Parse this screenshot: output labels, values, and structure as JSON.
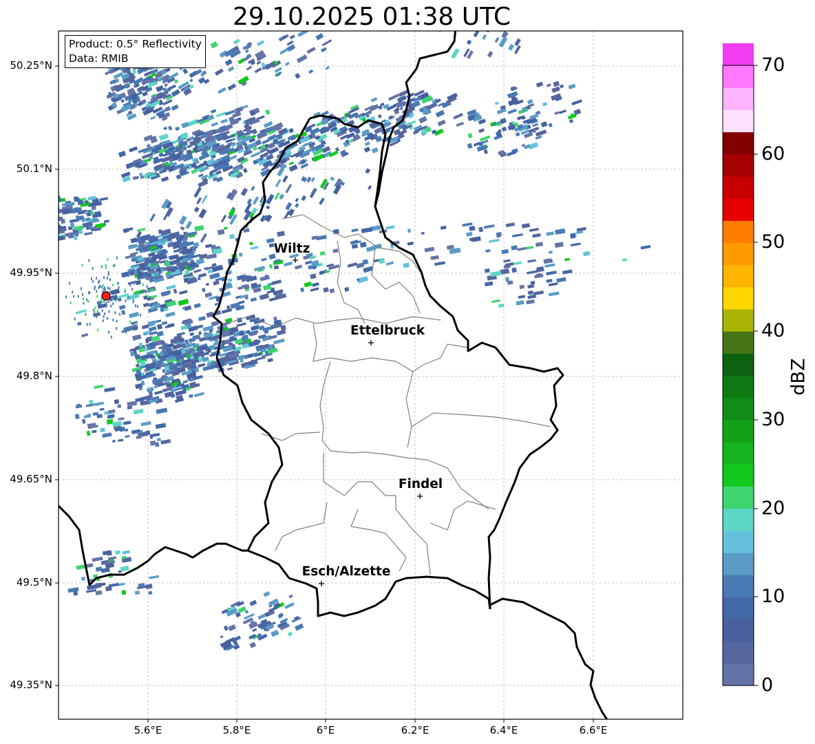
{
  "title": "29.10.2025 01:38 UTC",
  "info": {
    "product": "Product: 0.5° Reflectivity",
    "source": "Data: RMIB"
  },
  "axes": {
    "lat_labels": [
      "50.25°N",
      "50.1°N",
      "49.95°N",
      "49.8°N",
      "49.65°N",
      "49.5°N",
      "49.35°N"
    ],
    "lon_labels": [
      "5.6°E",
      "5.8°E",
      "6°E",
      "6.2°E",
      "6.4°E",
      "6.6°E"
    ]
  },
  "cities": [
    {
      "name": "Wiltz",
      "lon": 5.933,
      "lat": 49.966
    },
    {
      "name": "Ettelbruck",
      "lon": 6.104,
      "lat": 49.847
    },
    {
      "name": "Findel",
      "lon": 6.21,
      "lat": 49.626
    },
    {
      "name": "Esch/Alzette",
      "lon": 5.99,
      "lat": 49.496
    }
  ],
  "radar_site": {
    "lon": 5.505,
    "lat": 49.914,
    "color": "#ff2020"
  },
  "colorbar": {
    "label": "dBZ",
    "ticks": [
      "0",
      "10",
      "20",
      "30",
      "40",
      "50",
      "60",
      "70"
    ],
    "colors": [
      "#6574a8",
      "#56669f",
      "#48609e",
      "#4268a8",
      "#4a7ab4",
      "#5a9cc6",
      "#66c2dc",
      "#5ed6c6",
      "#3ed46e",
      "#12c81e",
      "#14b41e",
      "#12a21a",
      "#108c16",
      "#0e7a14",
      "#0c6210",
      "#457516",
      "#aab406",
      "#ffd600",
      "#ffb400",
      "#ff9a00",
      "#ff7c00",
      "#e80000",
      "#c80000",
      "#a40000",
      "#820000",
      "#ffe0ff",
      "#ffb4ff",
      "#ff78ff",
      "#ee3cee"
    ]
  }
}
